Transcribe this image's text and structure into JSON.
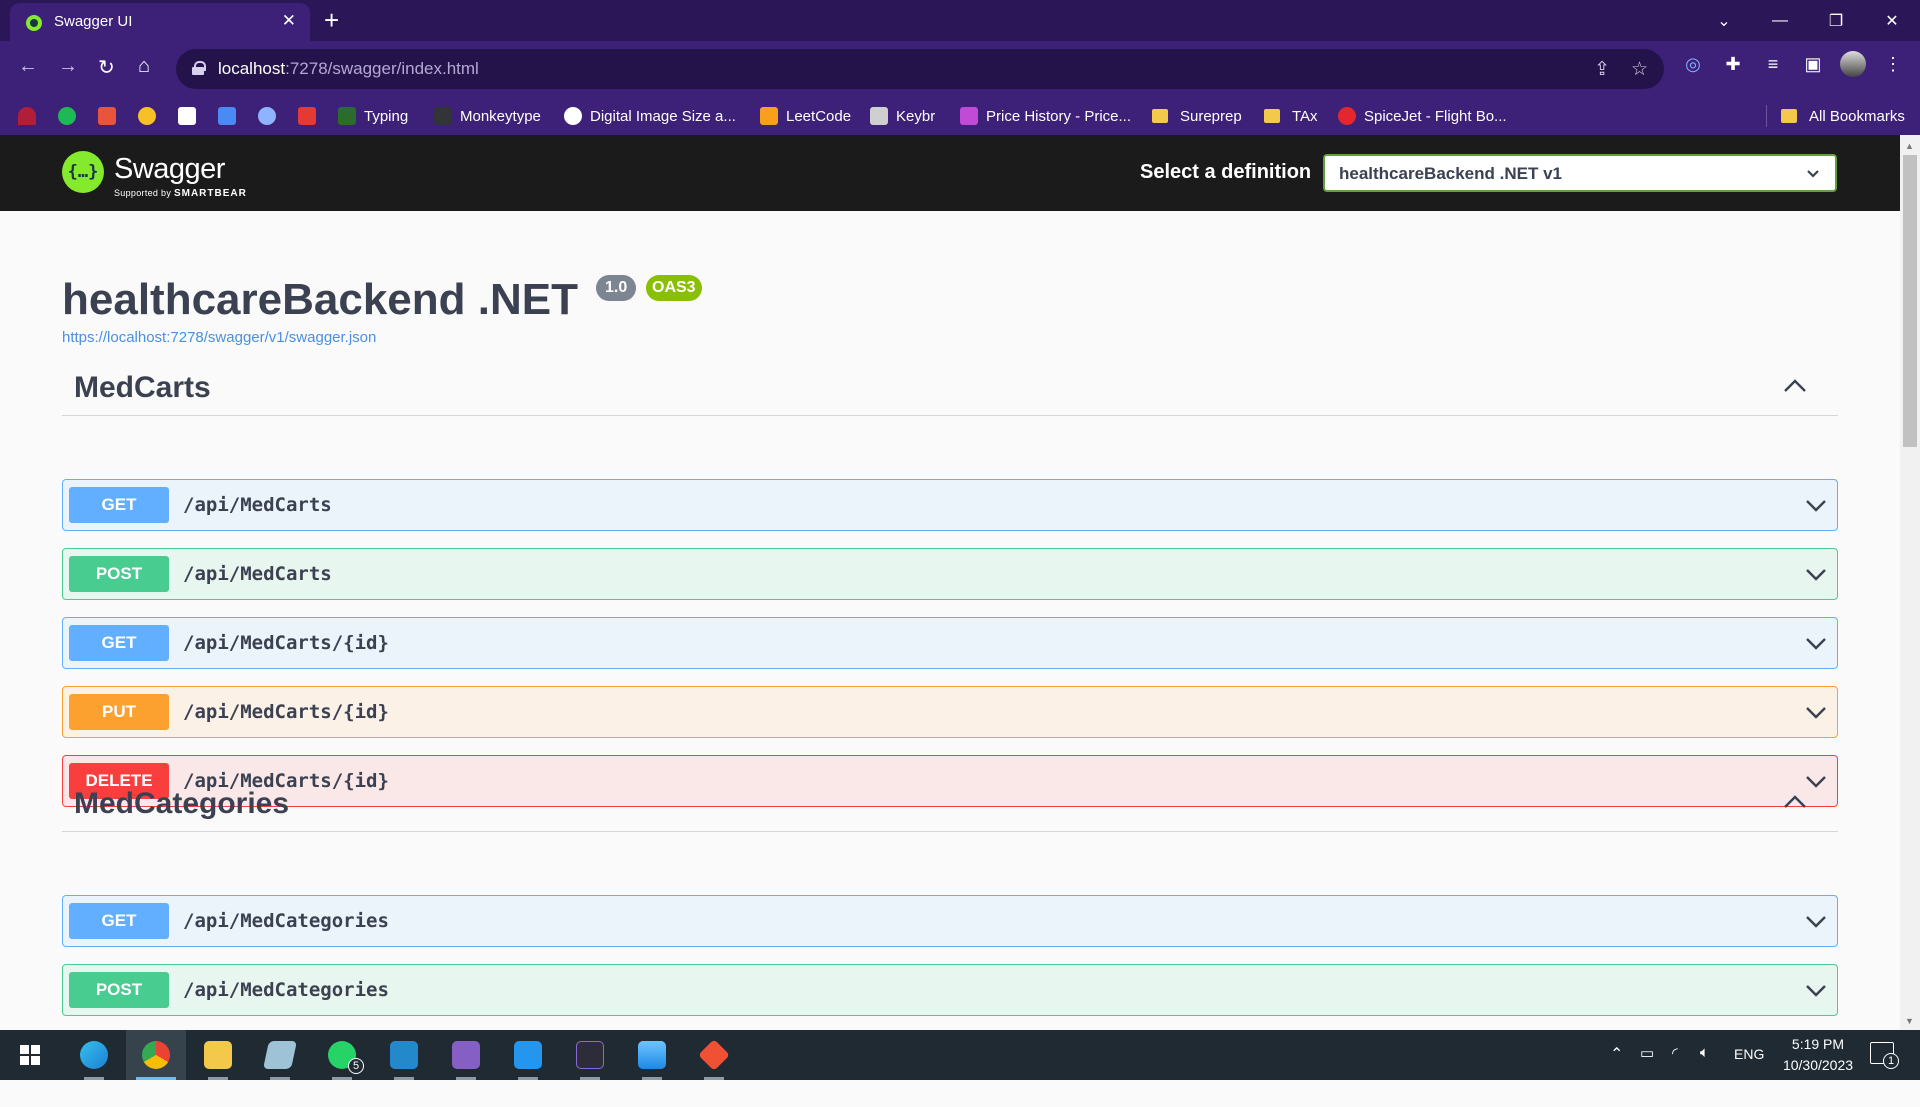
{
  "browser": {
    "tab_title": "Swagger UI",
    "tab_close": "✕",
    "new_tab": "+",
    "url_host": "localhost",
    "url_path": ":7278/swagger/index.html",
    "bookmarks": [
      "Typing",
      "Monkeytype",
      "Digital Image Size a...",
      "LeetCode",
      "Keybr",
      "Price History - Price...",
      "Sureprep",
      "TAx",
      "SpiceJet - Flight Bo..."
    ],
    "all_bookmarks": "All Bookmarks"
  },
  "swagger": {
    "logo_text": "Swagger",
    "logo_sub_prefix": "Supported by",
    "logo_sub_brand": "SMARTBEAR",
    "definition_label": "Select a definition",
    "definition_value": "healthcareBackend .NET v1",
    "title": "healthcareBackend .NET",
    "version": "1.0",
    "oas": "OAS3",
    "spec_url": "https://localhost:7278/swagger/v1/swagger.json"
  },
  "tags": [
    {
      "name": "MedCarts",
      "operations": [
        {
          "method": "GET",
          "path": "/api/MedCarts"
        },
        {
          "method": "POST",
          "path": "/api/MedCarts"
        },
        {
          "method": "GET",
          "path": "/api/MedCarts/{id}"
        },
        {
          "method": "PUT",
          "path": "/api/MedCarts/{id}"
        },
        {
          "method": "DELETE",
          "path": "/api/MedCarts/{id}"
        }
      ]
    },
    {
      "name": "MedCategories",
      "operations": [
        {
          "method": "GET",
          "path": "/api/MedCategories"
        },
        {
          "method": "POST",
          "path": "/api/MedCategories"
        }
      ]
    }
  ],
  "taskbar": {
    "language": "ENG",
    "time": "5:19 PM",
    "date": "10/30/2023",
    "whatsapp_badge": "5",
    "notification_badge": "1"
  }
}
